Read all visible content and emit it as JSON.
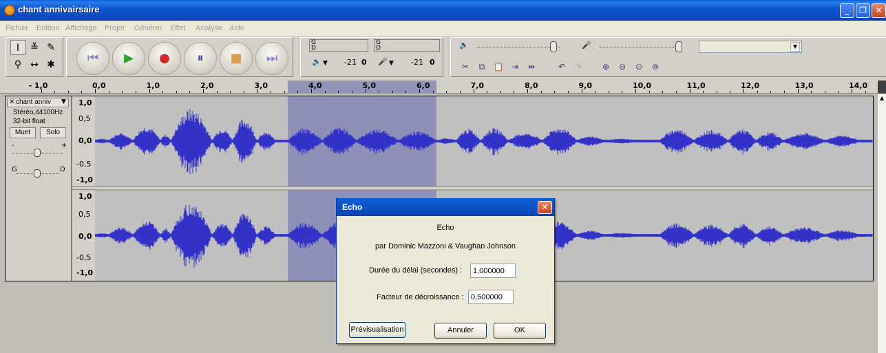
{
  "window": {
    "title": "chant annivairsaire",
    "minimize": "_",
    "restore": "❐",
    "close": "✕"
  },
  "menu": [
    "Fichier",
    "Edition",
    "Affichage",
    "Projet",
    "Générer",
    "Effet",
    "Analyse",
    "Aide"
  ],
  "meters": {
    "output_label": "G",
    "output_label2": "D",
    "input_label": "G",
    "input_label2": "D",
    "output_scale": [
      "-21",
      "0"
    ],
    "input_scale": [
      "-21",
      "0"
    ]
  },
  "ruler": {
    "labels": [
      "- 1,0",
      "0,0",
      "1,0",
      "2,0",
      "3,0",
      "4,0",
      "5,0",
      "6,0",
      "7,0",
      "8,0",
      "9,0",
      "10,0",
      "11,0",
      "12,0",
      "13,0",
      "14,0"
    ]
  },
  "track": {
    "name": "chant anniv",
    "format": "Stéréo,44100Hz",
    "bits": "32-bit float",
    "mute": "Muet",
    "solo": "Solo",
    "gain_minus": "-",
    "gain_plus": "+",
    "pan_left": "G",
    "pan_right": "D",
    "scale_top": [
      "1,0",
      "0,5",
      "0,0",
      "-0,5",
      "-1,0"
    ],
    "scale_bottom": [
      "1,0",
      "0,5",
      "0,0",
      "-0,5",
      "-1,0"
    ]
  },
  "colors": {
    "waveform": "#3232c8",
    "selection": "#8e90b8",
    "titlebar": "#0a5fd8"
  },
  "dialog": {
    "title": "Echo",
    "heading": "Echo",
    "author": "par Dominic Mazzoni & Vaughan Johnson",
    "delay_label": "Durée du délai (secondes) :",
    "delay_value": "1,000000",
    "decay_label": "Facteur de décroissance :",
    "decay_value": "0,500000",
    "preview": "Prévisualisation",
    "cancel": "Annuler",
    "ok": "OK"
  }
}
